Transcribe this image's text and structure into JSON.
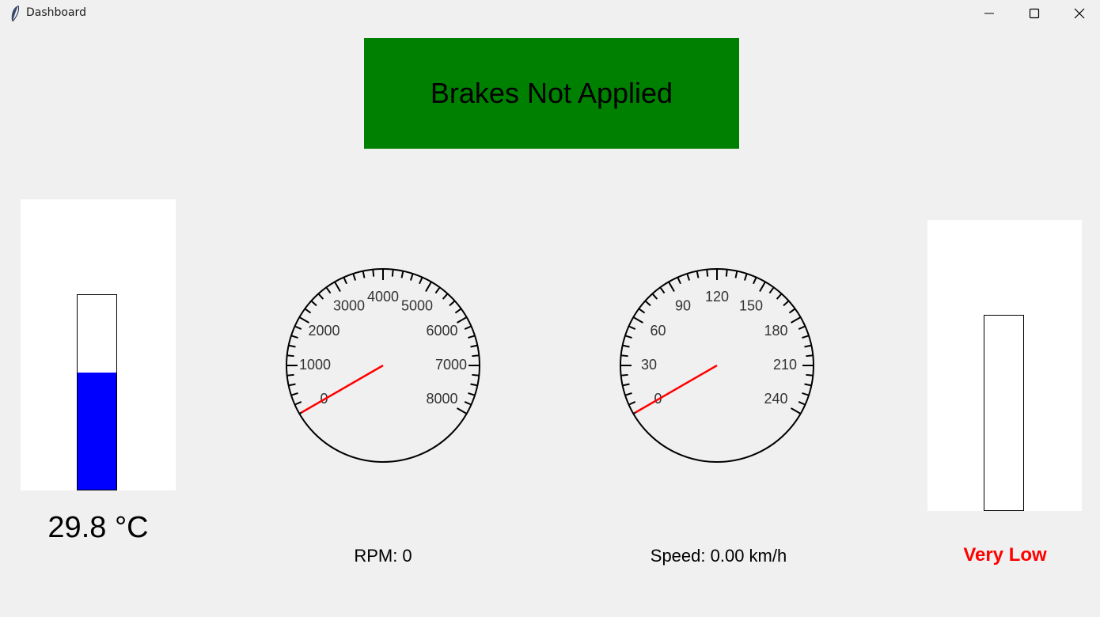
{
  "window": {
    "title": "Dashboard",
    "icon": "feather-icon"
  },
  "brakes": {
    "status_text": "Brakes Not Applied",
    "color": "#008000"
  },
  "temperature": {
    "value_c": 29.8,
    "readout": "29.8 °C",
    "level_fraction": 0.6,
    "fill_color": "#0000ff"
  },
  "rpm_gauge": {
    "min": 0,
    "max": 8000,
    "major_step": 1000,
    "tick_labels": [
      "0",
      "1000",
      "2000",
      "3000",
      "4000",
      "5000",
      "6000",
      "7000",
      "8000"
    ],
    "value": 0,
    "needle_color": "#ff0000",
    "readout": "RPM: 0"
  },
  "speed_gauge": {
    "min": 0,
    "max": 240,
    "major_step": 30,
    "tick_labels": [
      "0",
      "30",
      "60",
      "90",
      "120",
      "150",
      "180",
      "210",
      "240"
    ],
    "value": 0,
    "unit": "km/h",
    "needle_color": "#ff0000",
    "readout": "Speed: 0.00 km/h"
  },
  "fuel": {
    "status_text": "Very Low",
    "status_color": "#ff0000",
    "level_fraction": 0.0
  }
}
